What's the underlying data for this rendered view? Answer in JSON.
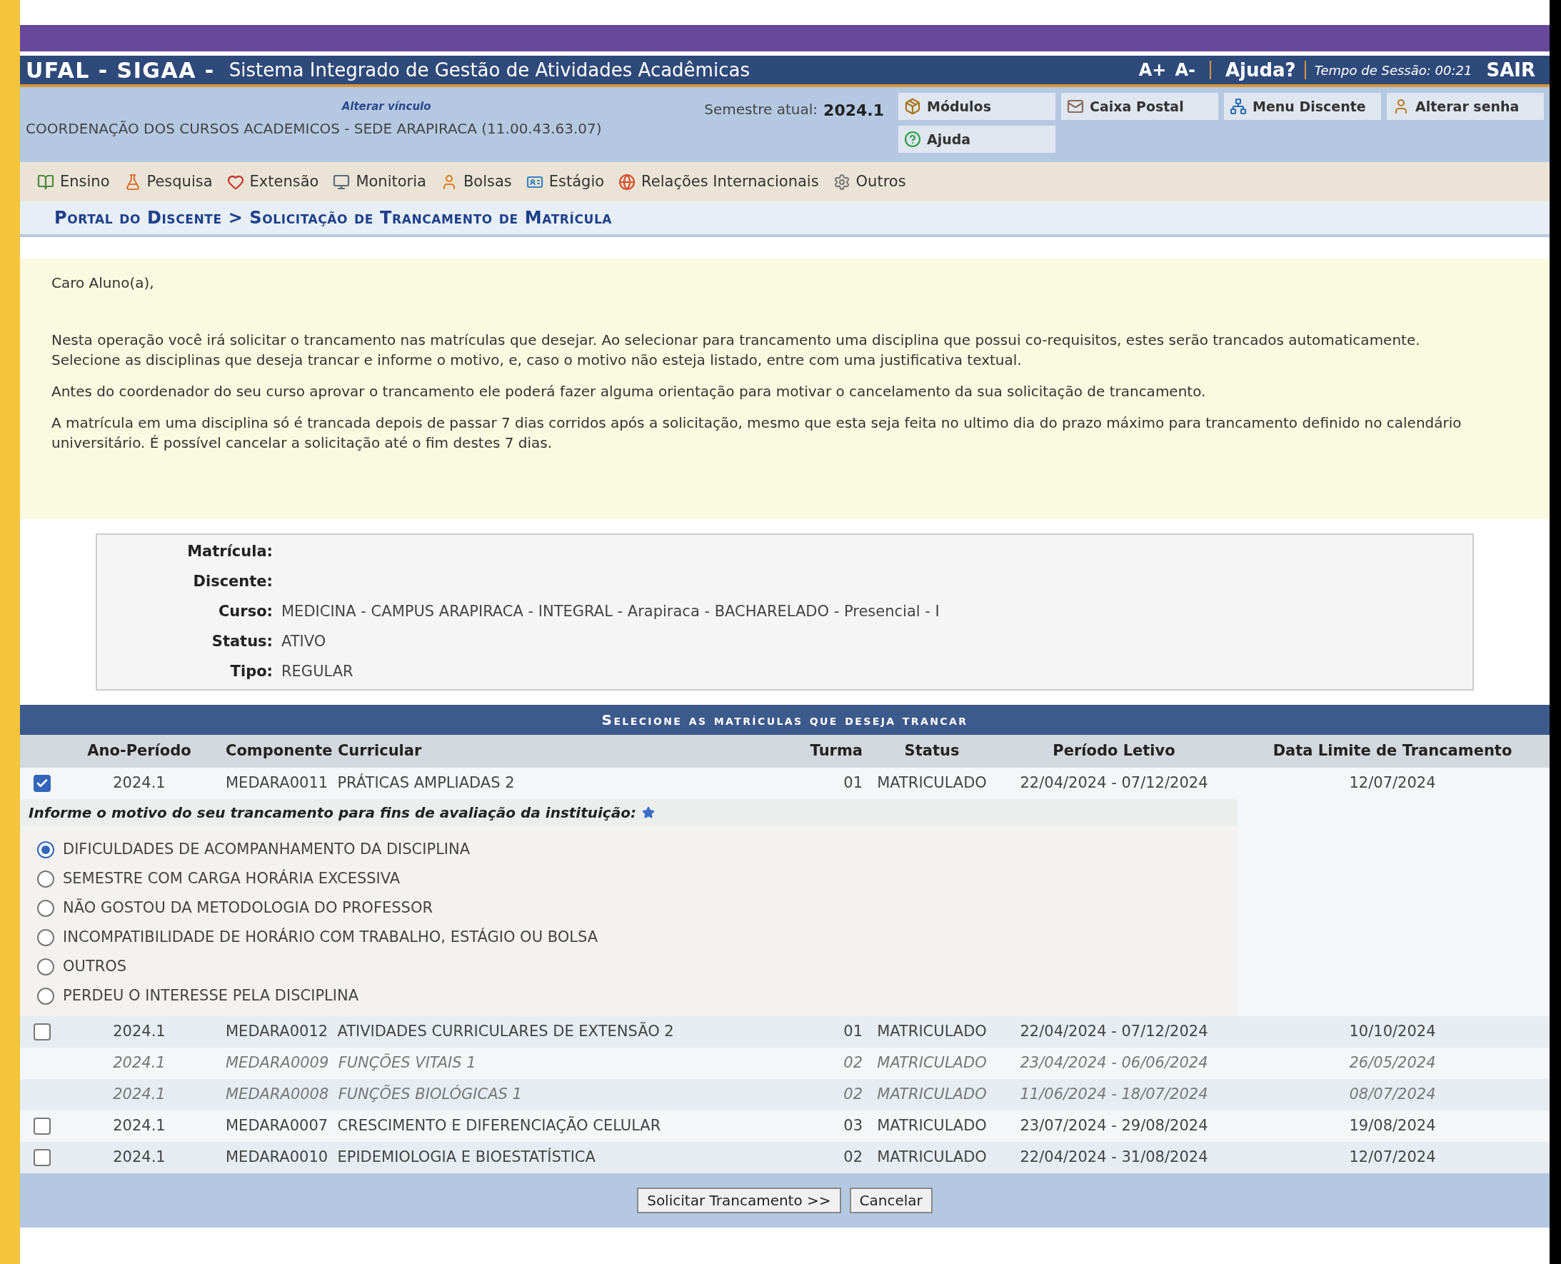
{
  "header": {
    "system": "UFAL - SIGAA -",
    "title": "Sistema Integrado de Gestão de Atividades Acadêmicas",
    "font_up": "A+",
    "font_down": "A-",
    "help": "Ajuda?",
    "session_label": "Tempo de Sessão:",
    "session_time": "00:21",
    "logout": "SAIR"
  },
  "info": {
    "change_link": "Alterar vínculo",
    "unit": "COORDENAÇÃO DOS CURSOS ACADEMICOS - SEDE ARAPIRACA (11.00.43.63.07)",
    "semester_label": "Semestre atual:",
    "semester": "2024.1",
    "shortcuts": [
      {
        "label": "Módulos",
        "kind": "box"
      },
      {
        "label": "Caixa Postal",
        "kind": "mail"
      },
      {
        "label": "Menu Discente",
        "kind": "tree"
      },
      {
        "label": "Alterar senha",
        "kind": "person"
      },
      {
        "label": "Ajuda",
        "kind": "help"
      }
    ]
  },
  "menu": [
    {
      "label": "Ensino",
      "kind": "books"
    },
    {
      "label": "Pesquisa",
      "kind": "flask"
    },
    {
      "label": "Extensão",
      "kind": "heart"
    },
    {
      "label": "Monitoria",
      "kind": "monitor"
    },
    {
      "label": "Bolsas",
      "kind": "person"
    },
    {
      "label": "Estágio",
      "kind": "badge"
    },
    {
      "label": "Relações Internacionais",
      "kind": "globe"
    },
    {
      "label": "Outros",
      "kind": "gear"
    }
  ],
  "breadcrumb": "Portal do Discente > Solicitação de Trancamento de Matrícula",
  "notice": [
    "Caro Aluno(a),",
    "Nesta operação você irá solicitar o trancamento nas matrículas que desejar. Ao selecionar para trancamento uma disciplina que possui co-requisitos, estes serão trancados automaticamente. Selecione as disciplinas que deseja trancar e informe o motivo, e, caso o motivo não esteja listado, entre com uma justificativa textual.",
    "Antes do coordenador do seu curso aprovar o trancamento ele poderá fazer alguma orientação para motivar o cancelamento da sua solicitação de trancamento.",
    "A matrícula em uma disciplina só é trancada depois de passar 7 dias corridos após a solicitação, mesmo que esta seja feita no ultimo dia do prazo máximo para trancamento definido no calendário universitário. É possível cancelar a solicitação até o fim destes 7 dias."
  ],
  "student": [
    {
      "label": "Matrícula:"
    },
    {
      "label": "Discente:"
    },
    {
      "label": "Curso:",
      "value": "MEDICINA - CAMPUS ARAPIRACA - INTEGRAL - Arapiraca - BACHARELADO - Presencial - I"
    },
    {
      "label": "Status:",
      "value": "ATIVO"
    },
    {
      "label": "Tipo:",
      "value": "REGULAR"
    }
  ],
  "table": {
    "title": "Selecione as matrículas que deseja trancar",
    "columns": [
      "Ano-Período",
      "Componente Curricular",
      "Turma",
      "Status",
      "Período Letivo",
      "Data Limite de Trancamento"
    ],
    "rows": [
      {
        "kind": "selectable",
        "checked": true,
        "period": "2024.1",
        "component": "MEDARA0011  PRÁTICAS AMPLIADAS 2",
        "class": "01",
        "status": "MATRICULADO",
        "term": "22/04/2024 - 07/12/2024",
        "deadline": "12/07/2024",
        "reason_prompt": "Informe o motivo do seu trancamento para fins de avaliação da instituição:",
        "reasons": [
          {
            "label": "DIFICULDADES DE ACOMPANHAMENTO DA DISCIPLINA",
            "selected": true
          },
          {
            "label": "SEMESTRE COM CARGA HORÁRIA EXCESSIVA",
            "selected": false
          },
          {
            "label": "NÃO GOSTOU DA METODOLOGIA DO PROFESSOR",
            "selected": false
          },
          {
            "label": "INCOMPATIBILIDADE DE HORÁRIO COM TRABALHO, ESTÁGIO OU BOLSA",
            "selected": false
          },
          {
            "label": "OUTROS",
            "selected": false
          },
          {
            "label": "PERDEU O INTERESSE PELA DISCIPLINA",
            "selected": false
          }
        ]
      },
      {
        "kind": "selectable",
        "checked": false,
        "period": "2024.1",
        "component": "MEDARA0012  ATIVIDADES CURRICULARES DE EXTENSÃO 2",
        "class": "01",
        "status": "MATRICULADO",
        "term": "22/04/2024 - 07/12/2024",
        "deadline": "10/10/2024"
      },
      {
        "kind": "locked",
        "period": "2024.1",
        "component": "MEDARA0009  FUNÇÕES VITAIS 1",
        "class": "02",
        "status": "MATRICULADO",
        "term": "23/04/2024 - 06/06/2024",
        "deadline": "26/05/2024"
      },
      {
        "kind": "locked",
        "period": "2024.1",
        "component": "MEDARA0008  FUNÇÕES BIOLÓGICAS 1",
        "class": "02",
        "status": "MATRICULADO",
        "term": "11/06/2024 - 18/07/2024",
        "deadline": "08/07/2024"
      },
      {
        "kind": "selectable",
        "checked": false,
        "period": "2024.1",
        "component": "MEDARA0007  CRESCIMENTO E DIFERENCIAÇÃO CELULAR",
        "class": "03",
        "status": "MATRICULADO",
        "term": "23/07/2024 - 29/08/2024",
        "deadline": "19/08/2024"
      },
      {
        "kind": "selectable",
        "checked": false,
        "period": "2024.1",
        "component": "MEDARA0010  EPIDEMIOLOGIA E BIOESTATÍSTICA",
        "class": "02",
        "status": "MATRICULADO",
        "term": "22/04/2024 - 31/08/2024",
        "deadline": "12/07/2024"
      }
    ]
  },
  "buttons": [
    "Solicitar Trancamento >>",
    "Cancelar"
  ]
}
